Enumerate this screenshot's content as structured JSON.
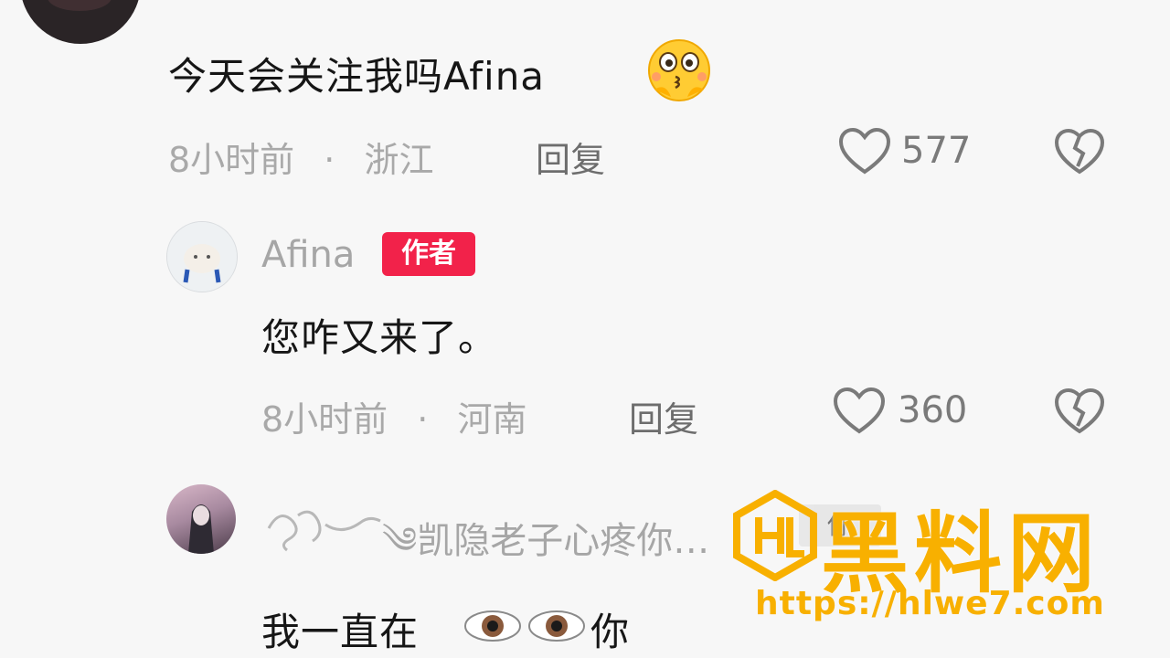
{
  "comments": [
    {
      "text": "今天会关注我吗Afina",
      "time": "8小时前",
      "separator": "·",
      "location": "浙江",
      "reply_label": "回复",
      "like_count": "577"
    },
    {
      "username": "Afina",
      "badge": "作者",
      "text": "您咋又来了。",
      "time": "8小时前",
      "separator": "·",
      "location": "河南",
      "reply_label": "回复",
      "like_count": "360"
    },
    {
      "username": "༄凯隐老子心疼你…",
      "follow_label": "你",
      "text_before": "我一直在",
      "text_after": "你"
    }
  ],
  "watermark": {
    "title": "黑料网",
    "url": "https://hlwe7.com",
    "brand_color": "#f8b000"
  },
  "colors": {
    "badge": "#f2224a",
    "meta": "#a9a9a9"
  }
}
